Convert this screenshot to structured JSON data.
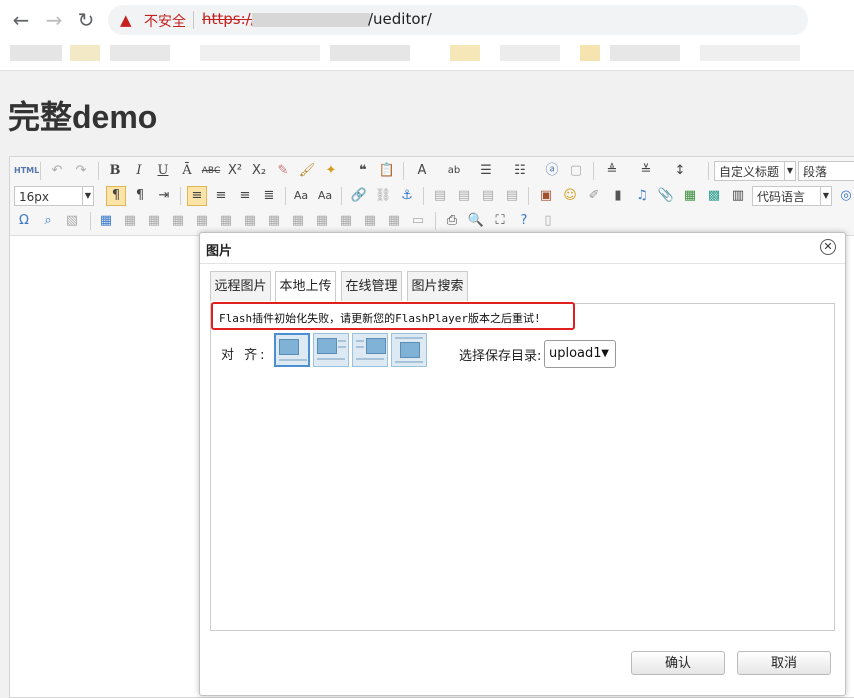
{
  "browser": {
    "security_label": "不安全",
    "url_scheme": "https://",
    "url_path": "/ueditor/"
  },
  "page": {
    "title": "完整demo"
  },
  "toolbar": {
    "html_label": "HTML",
    "font_size": "16px",
    "heading_combo": "自定义标题",
    "paragraph_combo": "段落",
    "code_lang_combo": "代码语言"
  },
  "dialog": {
    "title": "图片",
    "tabs": [
      "远程图片",
      "本地上传",
      "在线管理",
      "图片搜索"
    ],
    "selected_tab": "本地上传",
    "flash_error": "Flash插件初始化失败，请更新您的FlashPlayer版本之后重试!",
    "align_label": "对 齐:",
    "save_dir_label": "选择保存目录:",
    "save_dir_value": "upload1",
    "ok_label": "确认",
    "cancel_label": "取消"
  },
  "colors": {
    "error_red": "#e02020",
    "insecure_red": "#c5221f",
    "active_button": "#fde5a8"
  }
}
